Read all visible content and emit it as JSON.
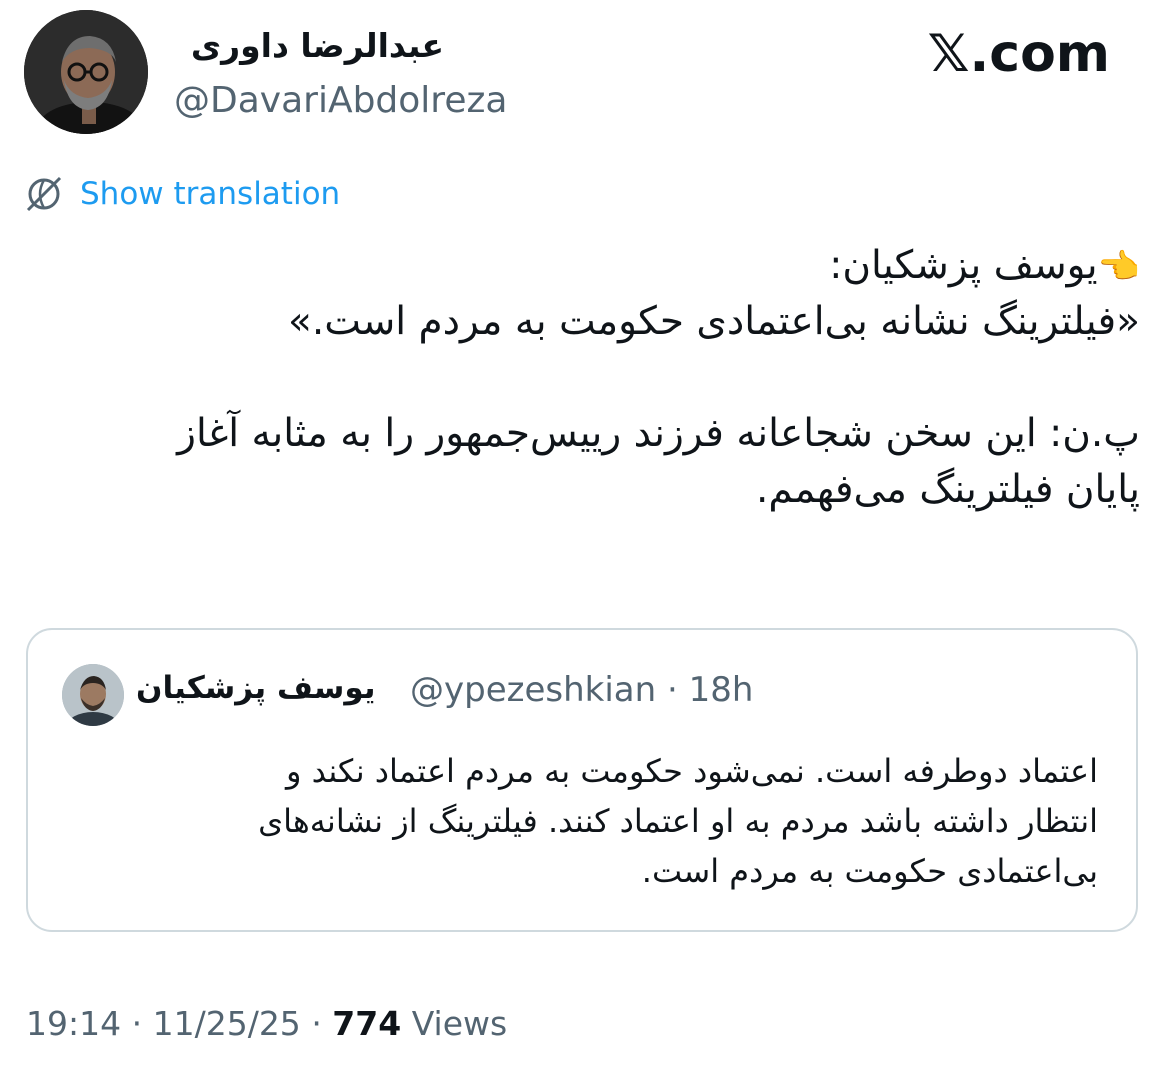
{
  "watermark": "𝕏.com",
  "author": {
    "name": "عبدالرضا داوری",
    "handle": "@DavariAbdolreza",
    "avatar_icon": "person-photo-avatar"
  },
  "translate": {
    "label": "Show translation",
    "icon": "translate-globe-icon",
    "color": "#1d9bf0"
  },
  "tweet": {
    "lines": [
      "👈",
      "یوسف پزشکیان:",
      "«فیلترینگ نشانه بی‌اعتمادی حکومت به مردم است.»",
      "پ.ن: این سخن شجاعانه فرزند رییس‌جمهور را به مثابه آغاز",
      "پایان فیلترینگ می‌فهمم."
    ]
  },
  "quote": {
    "name": "یوسف پزشکیان",
    "handle": "@ypezeshkian",
    "time": "· 18h",
    "lines": [
      "اعتماد دوطرفه است. نمی‌شود حکومت به مردم اعتماد نکند و",
      "انتظار داشته باشد مردم به او اعتماد کنند. فیلترینگ از نشانه‌های",
      "بی‌اعتمادی حکومت به مردم است."
    ]
  },
  "meta": {
    "time": "19:14",
    "date": "11/25/25",
    "views_count": "774",
    "views_label": "Views"
  },
  "colors": {
    "text": "#0f1419",
    "secondary": "#536471",
    "border": "#cfd9de",
    "link": "#1d9bf0"
  }
}
